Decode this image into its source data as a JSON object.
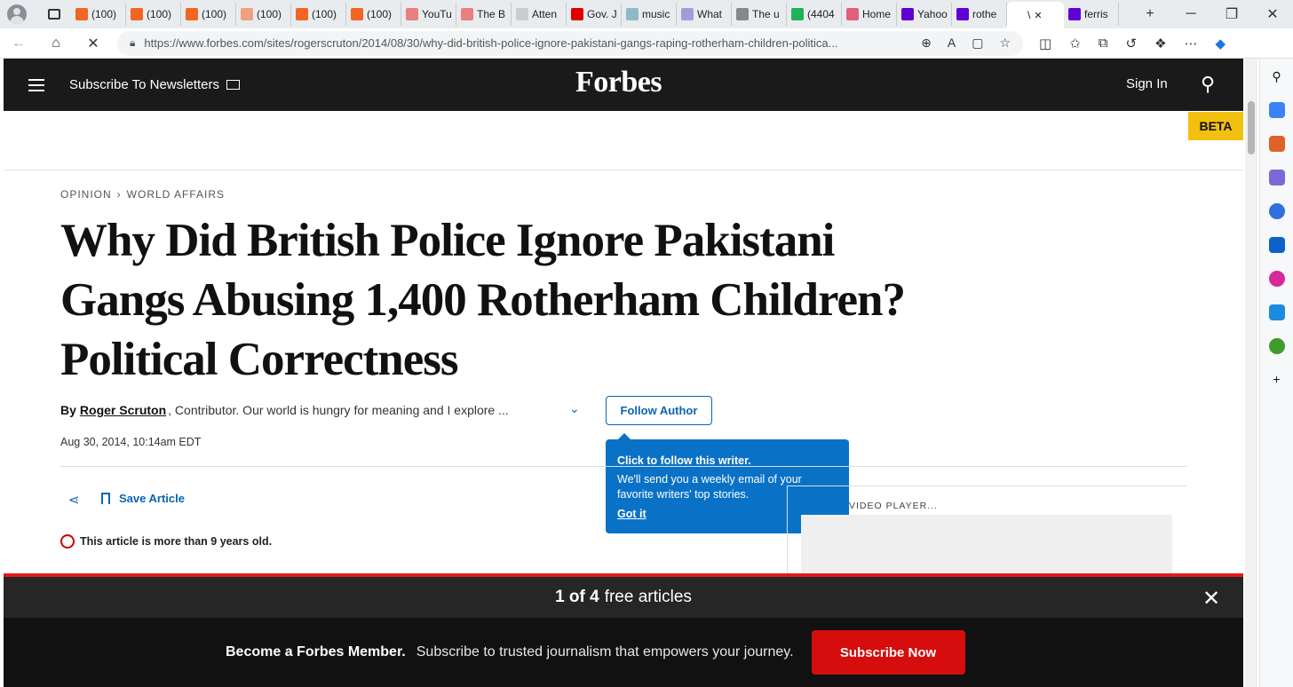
{
  "browser": {
    "tabs": [
      {
        "label": "(100)",
        "icon": "substack-icon",
        "color": "#f26522"
      },
      {
        "label": "(100)",
        "icon": "substack-icon",
        "color": "#f26522"
      },
      {
        "label": "(100)",
        "icon": "substack-icon",
        "color": "#f26522"
      },
      {
        "label": "(100)",
        "icon": "substack-icon",
        "color": "#f0a080"
      },
      {
        "label": "(100)",
        "icon": "substack-icon",
        "color": "#f26522"
      },
      {
        "label": "(100)",
        "icon": "substack-icon",
        "color": "#f26522"
      },
      {
        "label": "YouTu",
        "icon": "youtube-icon",
        "color": "#e88080"
      },
      {
        "label": "The B",
        "icon": "youtube-icon",
        "color": "#e88080"
      },
      {
        "label": "Atten",
        "icon": "document-icon",
        "color": "#cccccc"
      },
      {
        "label": "Gov. J",
        "icon": "youtube-icon",
        "color": "#e00000"
      },
      {
        "label": "music",
        "icon": "music-icon",
        "color": "#8fb8c8"
      },
      {
        "label": "What",
        "icon": "shield-icon",
        "color": "#a89ad8"
      },
      {
        "label": "The u",
        "icon": "grid-icon",
        "color": "#888888"
      },
      {
        "label": "(4404",
        "icon": "g-icon",
        "color": "#1fb25a"
      },
      {
        "label": "Home",
        "icon": "podcast-icon",
        "color": "#e0607a"
      },
      {
        "label": "Yahoo",
        "icon": "yahoo-icon",
        "color": "#6001d2"
      },
      {
        "label": "rothe",
        "icon": "yahoo-icon",
        "color": "#6001d2"
      },
      {
        "label": "\\",
        "icon": "forbes-icon",
        "color": "#ffffff",
        "active": true
      },
      {
        "label": "ferris",
        "icon": "yahoo-icon",
        "color": "#6001d2"
      }
    ],
    "url": "https://www.forbes.com/sites/rogerscruton/2014/08/30/why-did-british-police-ignore-pakistani-gangs-raping-rotherham-children-politica..."
  },
  "header": {
    "subscribe_label": "Subscribe To Newsletters",
    "logo": "Forbes",
    "signin_label": "Sign In",
    "beta_label": "BETA"
  },
  "article": {
    "breadcrumb": [
      "OPINION",
      "WORLD AFFAIRS"
    ],
    "title": "Why Did British Police Ignore Pakistani Gangs Abusing 1,400 Rotherham Children? Political Correctness",
    "by": "By",
    "author": "Roger Scruton",
    "author_desc": ", Contributor. Our world is hungry for meaning and I explore ...",
    "follow_label": "Follow Author",
    "date": "Aug 30, 2014, 10:14am EDT",
    "save_label": "Save Article",
    "old_notice": "This article is more than 9 years old."
  },
  "tooltip": {
    "title": "Click to follow this writer.",
    "body": "We'll send you a weekly email of your favorite writers' top stories.",
    "gotit": "Got it"
  },
  "video": {
    "label": "VIDEO PLAYER..."
  },
  "paywall": {
    "count": "1 of 4",
    "free_label": "free articles",
    "become": "Become a Forbes Member.",
    "subtext": "Subscribe to trusted journalism that empowers your journey.",
    "cta": "Subscribe Now"
  }
}
